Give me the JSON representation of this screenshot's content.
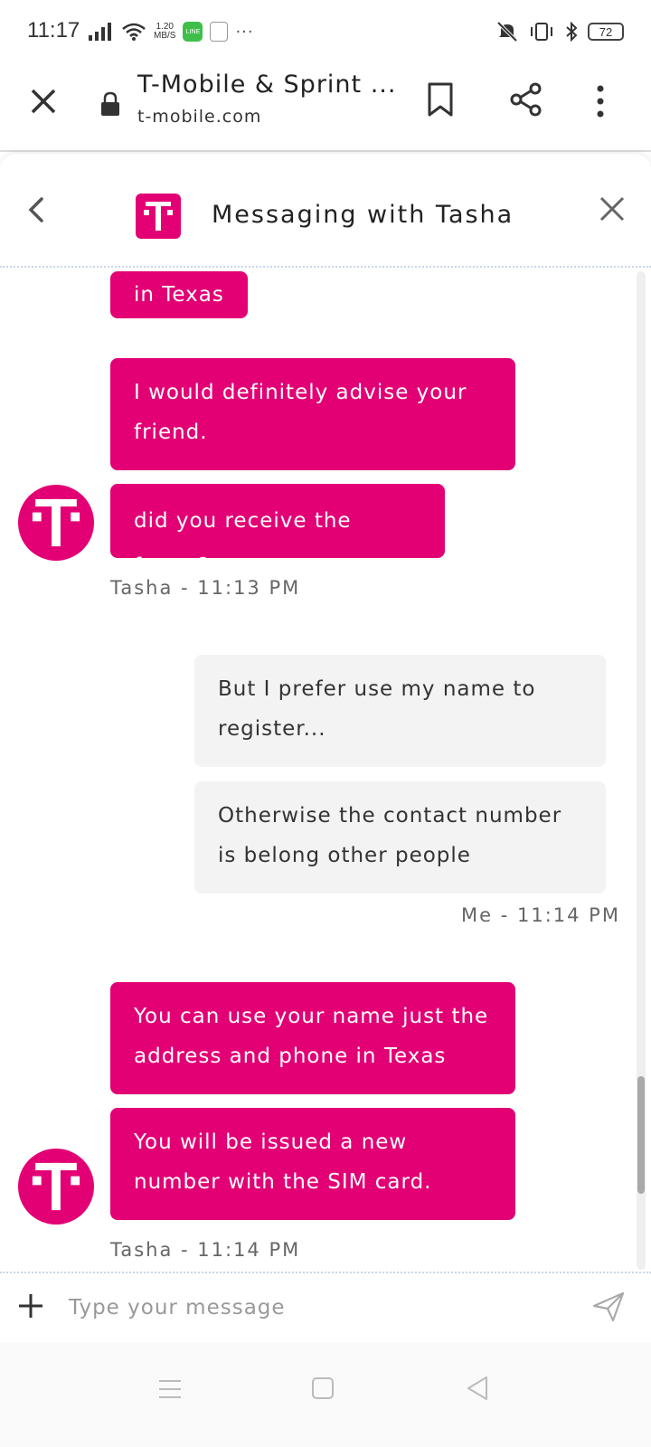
{
  "status_bar": {
    "time": "11:17",
    "net_speed_value": "1.20",
    "net_speed_unit": "MB/S",
    "line_label": "LINE",
    "battery": "72",
    "more": "···"
  },
  "browser": {
    "title": "T-Mobile & Sprint ...",
    "url": "t-mobile.com"
  },
  "chat": {
    "header_title": "Messaging with Tasha",
    "brand_letter": "T",
    "accent_color": "#e20074",
    "messages": [
      {
        "sender": "agent",
        "text": "in Texas"
      },
      {
        "sender": "agent",
        "text": "I would definitely advise your friend."
      },
      {
        "sender": "agent",
        "text": "did you receive the forms?"
      },
      {
        "sender": "me",
        "text": "But I prefer use my name to register..."
      },
      {
        "sender": "me",
        "text": "Otherwise the contact number is belong other people"
      },
      {
        "sender": "agent",
        "text": "You can use your name just the address and phone in Texas"
      },
      {
        "sender": "agent",
        "text": "You will be issued a new number with the SIM card."
      }
    ],
    "stamps": [
      "Tasha - 11:13 PM",
      "Me - 11:14 PM",
      "Tasha - 11:14 PM"
    ],
    "input_placeholder": "Type your message"
  },
  "icons": {
    "close": "close-icon",
    "lock": "lock-icon",
    "bookmark": "bookmark-icon",
    "share": "share-icon",
    "menu": "more-vertical-icon",
    "back": "chevron-left-icon",
    "plus": "plus-icon",
    "send": "send-icon"
  }
}
